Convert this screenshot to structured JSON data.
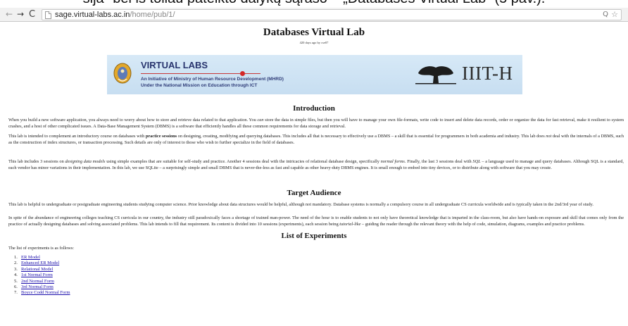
{
  "caption": {
    "text": "sija\" bei iš toliau pateikto dalykų sąrašo – „Databases Virtual Lab“ (5 pav.)."
  },
  "browser": {
    "back_glyph": "←",
    "forward_glyph": "→",
    "reload_glyph": "C",
    "url_host": "sage.virtual-labs.ac.in",
    "url_path": "/home/pub/1/",
    "zoom_glyph": "Q",
    "star_glyph": "☆"
  },
  "page": {
    "title": "Databases Virtual Lab",
    "visit_note": "420 days ago by cse07"
  },
  "banner": {
    "title": "VIRTUAL LABS",
    "subtitle_1": "An Initiative of Ministry of Human Resource Development (MHRD)",
    "subtitle_2": "Under the National Mission on Education through ICT",
    "institute": "IIIT-H",
    "colors": {
      "background": "#c7def1",
      "title": "#27336d",
      "accent": "#d42828"
    }
  },
  "sections": {
    "introduction": {
      "heading": "Introduction",
      "p1": {
        "a": "When you build a new software application, you always need to worry about how to store and retrieve data related to that application. You ",
        "em": "can",
        "b": " store the data in simple files, but then you will have to manage your own file-formats, write code to insert and delete data records, order or organize the data for fast retrieval, make it resilient to system crashes, and a host of other complicated issues. A Data-Base Management System (DBMS) is a software that efficiently handles all these common requirements for data storage and retrieval."
      },
      "p2": {
        "a": "This lab is intended to complement an introductory course on databases with ",
        "strong": "practice sessions",
        "b": " on designing, creating, modifying and querying databases. This includes all that is necessary to effectively use a DBMS – a skill that is essential for programmers in both academia and industry. This lab does ",
        "em": "not",
        "c": " deal with the internals of a DBMS, such as the construction of index structures, or transaction processing. Such details are only of interest to those who wish to further specialize in the field of databases."
      },
      "p3": {
        "a": "This lab includes 3 sessions on ",
        "em1": "designing data models",
        "b": " using simple examples that are suitable for self-study and practice. Another 4 sessions deal with the intricacies of relational database design, specifically ",
        "em2": "normal forms",
        "c": ". Finally, the last 3 sessions deal with ",
        "em3": "SQL",
        "d": " – a language used to manage and query databases. Although SQL is a standard, each vendor has minor variations in their implementation. In this lab, we use SQLite – a surprisingly simple and small DBMS that is never-the-less as fast and capable as other heavy-duty DBMS engines. It is small enough to embed into tiny devices, or to distribute along with software that you may create."
      }
    },
    "audience": {
      "heading": "Target Audience",
      "p1": "This lab is helpful to undergraduate or postgraduate engineering students studying computer science. Prior knowledge about data structures would be helpful, although not mandatory. Database systems is normally a compulsory course in all undergraduate CS curricula worldwide and is typically taken in the 2nd/3rd year of study.",
      "p2": {
        "a": "In spite of the abundance of engineering colleges teaching CS curricula in our country, the industry still paradoxically faces a shortage of trained man-power. The need of the hour is to enable students to not only have theoretical knowledge that is imparted in the class-room, but also have hands-on exposure and skill that comes only from the practice of actually designing databases and solving associated problems. This lab intends to fill that requirement. Its content is divided into 10 sessions (experiments), each session being ",
        "em": "tutorial-like",
        "b": " – guiding the reader through the relevant theory with the help of code, simulation, diagrams, examples and practice problems."
      }
    },
    "experiments": {
      "heading": "List of Experiments",
      "intro": "The list of experiments is as follows:",
      "items": [
        {
          "num": "1.",
          "label": "ER Model"
        },
        {
          "num": "2.",
          "label": "Enhanced ER Model"
        },
        {
          "num": "3.",
          "label": "Relational Model"
        },
        {
          "num": "4.",
          "label": "1st Normal Form"
        },
        {
          "num": "5.",
          "label": "2nd Normal Form"
        },
        {
          "num": "6.",
          "label": "3rd Normal Form"
        },
        {
          "num": "7.",
          "label": "Boyce Codd Normal Form"
        }
      ]
    }
  }
}
